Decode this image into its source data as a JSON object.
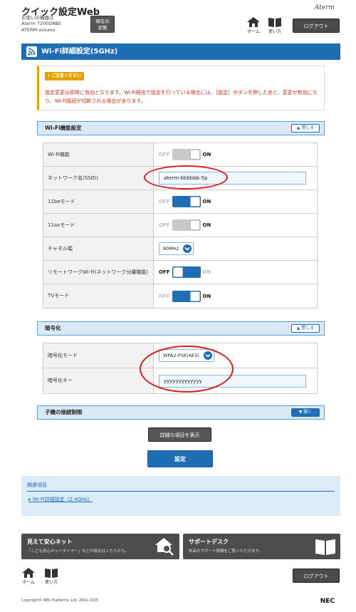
{
  "header": {
    "app_title": "クイック設定Web",
    "device_line1": "お使いの機器は",
    "device_line2": "Aterm 7200D8BE",
    "device_line3": "ATERM-xxxxxx",
    "status_line1": "現在の",
    "status_line2": "状態",
    "home_label": "ホーム",
    "help_label": "使い方",
    "logout_label": "ログアウト",
    "brand": "Aterm"
  },
  "page_title": "Wi-Fi詳細設定(5GHz)",
  "notice": {
    "badge": "ご注意ください",
    "text": "設定変更は即時に有効となります。Wi-Fi経由で設定を行っている場合には、［設定］ボタンを押したあと、変更が有効になり、Wi-Fi接続が切断される場合があります。"
  },
  "wifi_section": {
    "title": "Wi-Fi機能設定",
    "toggle_label": "閉じる",
    "rows": [
      {
        "label": "Wi-Fi機能",
        "off": "OFF",
        "on": "ON",
        "state": "on-disabled"
      },
      {
        "label": "ネットワーク名(SSID)",
        "value": "aterm-bbbbbb-5p"
      },
      {
        "label": "11beモード",
        "off": "OFF",
        "on": "ON",
        "state": "on"
      },
      {
        "label": "11axモード",
        "off": "OFF",
        "on": "ON",
        "state": "on-disabled"
      },
      {
        "label": "チャネル幅",
        "value": "80MHz"
      },
      {
        "label": "リモートワークWi-Fi(ネットワーク分離機能)",
        "off": "OFF",
        "on": "ON",
        "state": "off"
      },
      {
        "label": "TVモード",
        "off": "OFF",
        "on": "ON",
        "state": "on"
      }
    ]
  },
  "encryption_section": {
    "title": "暗号化",
    "toggle_label": "閉じる",
    "rows": [
      {
        "label": "暗号化モード",
        "value": "WPA2-PSK(AES)"
      },
      {
        "label": "暗号化キー",
        "value": "yyyyyyyyyyyyy"
      }
    ]
  },
  "child_section": {
    "title": "子機の接続制限",
    "toggle_label": "開く"
  },
  "buttons": {
    "show_details": "詳細な項目を表示",
    "submit": "設定"
  },
  "related": {
    "title": "関連項目",
    "link": "Wi-Fi詳細設定（2.4GHz）"
  },
  "banners": [
    {
      "title": "見えて安心ネット",
      "sub": "「こども安心ネットタイマー」などの設定はこちらから。"
    },
    {
      "title": "サポートデスク",
      "sub": "本品のサポート情報をご覧いただけます。"
    }
  ],
  "footer": {
    "home_label": "ホーム",
    "help_label": "使い方",
    "logout_label": "ログアウト",
    "copyright": "Copyright© NEC Platforms, Ltd. 2001-2025",
    "brand": "NEC"
  },
  "colors": {
    "accent": "#1f6eb4",
    "notice_text": "#c8331c",
    "notice_badge": "#e6a000",
    "annotation_ring": "#e01b1b"
  }
}
